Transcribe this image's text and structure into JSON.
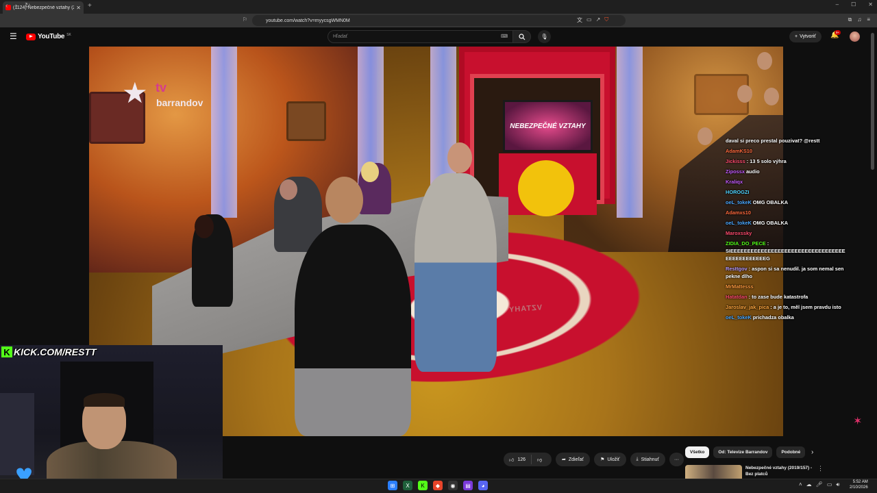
{
  "browser": {
    "tab_title": "(1124) Nebezpečné vztahy (2",
    "url": "youtube.com/watch?v=myycsgWMN0M"
  },
  "youtube": {
    "logo_text": "YouTube",
    "country_code": "SK",
    "search_placeholder": "Hľadať",
    "create_label": "Vytvoriť",
    "notif_count": "9+"
  },
  "video": {
    "channel_brand_tv": "tv",
    "channel_brand_name": "barrandov",
    "screen_text": "NEBEZPEČNÉ VZTAHY",
    "floor_text": "VZTAHY"
  },
  "chat": [
    {
      "user": "",
      "msg": "daval si preco prestal pouzivat? @restt",
      "color": "#ffffff"
    },
    {
      "user": "AdamKS10",
      "msg": "",
      "color": "#ff6a3d"
    },
    {
      "user": "Jickisss",
      "msg": ": 13 5 solo výhra",
      "color": "#ff4b6e"
    },
    {
      "user": "Zipossx",
      "msg": "audio",
      "color": "#c45cff"
    },
    {
      "user": "Kraliqx",
      "msg": "",
      "color": "#c45cff"
    },
    {
      "user": "HOROGZI",
      "msg": "",
      "color": "#4fd3ff"
    },
    {
      "user": "oeL_tokeK",
      "msg": "OMG OBALKA",
      "color": "#4aa8ff"
    },
    {
      "user": "Adamxs10",
      "msg": "",
      "color": "#ff6a3d"
    },
    {
      "user": "oeL_tokeK",
      "msg": "OMG OBALKA",
      "color": "#4aa8ff"
    },
    {
      "user": "Maroxssky",
      "msg": "",
      "color": "#ff4b6e"
    },
    {
      "user": "ZIDIA_DO_PECE",
      "msg": ": SIEEEEEEEEEEEEEEEEEEEEEEEEEEEEEEEEEEEEEEEEEEEEEEG",
      "color": "#53fc18"
    },
    {
      "user": "Resttgov",
      "msg": ": aspon si sa nenudil. ja som nemal sen pekne dlho",
      "color": "#b99cff"
    },
    {
      "user": "MrMattesss",
      "msg": "",
      "color": "#ff9a3d"
    },
    {
      "user": "Hatatdan",
      "msg": ": to zase bude katastrofa",
      "color": "#ff4b6e"
    },
    {
      "user": "Jaroslav_jak_pica",
      "msg": ": a je to, měl jsem pravdu isto",
      "color": "#ffa63d"
    },
    {
      "user": "oeL_tokeK",
      "msg": "prichadza obalka",
      "color": "#4aa8ff"
    }
  ],
  "overlay": {
    "kick_text": "KICK.COM/RESTT"
  },
  "actions": {
    "likes": "126",
    "share": "Zdieľať",
    "save": "Uložiť",
    "download": "Stiahnuť",
    "more": "···"
  },
  "chips": [
    "Všetko",
    "Od: Televize Barrandov",
    "Podobné"
  ],
  "recommendation": {
    "title": "Nebezpečné vztahy (2019/157) - Bez platců"
  },
  "taskbar": {
    "time": "5:52 AM",
    "date": "2/10/2026"
  },
  "colors": {
    "accent": "#ff0000",
    "kick_green": "#53fc18",
    "background": "#0f0f0f"
  }
}
